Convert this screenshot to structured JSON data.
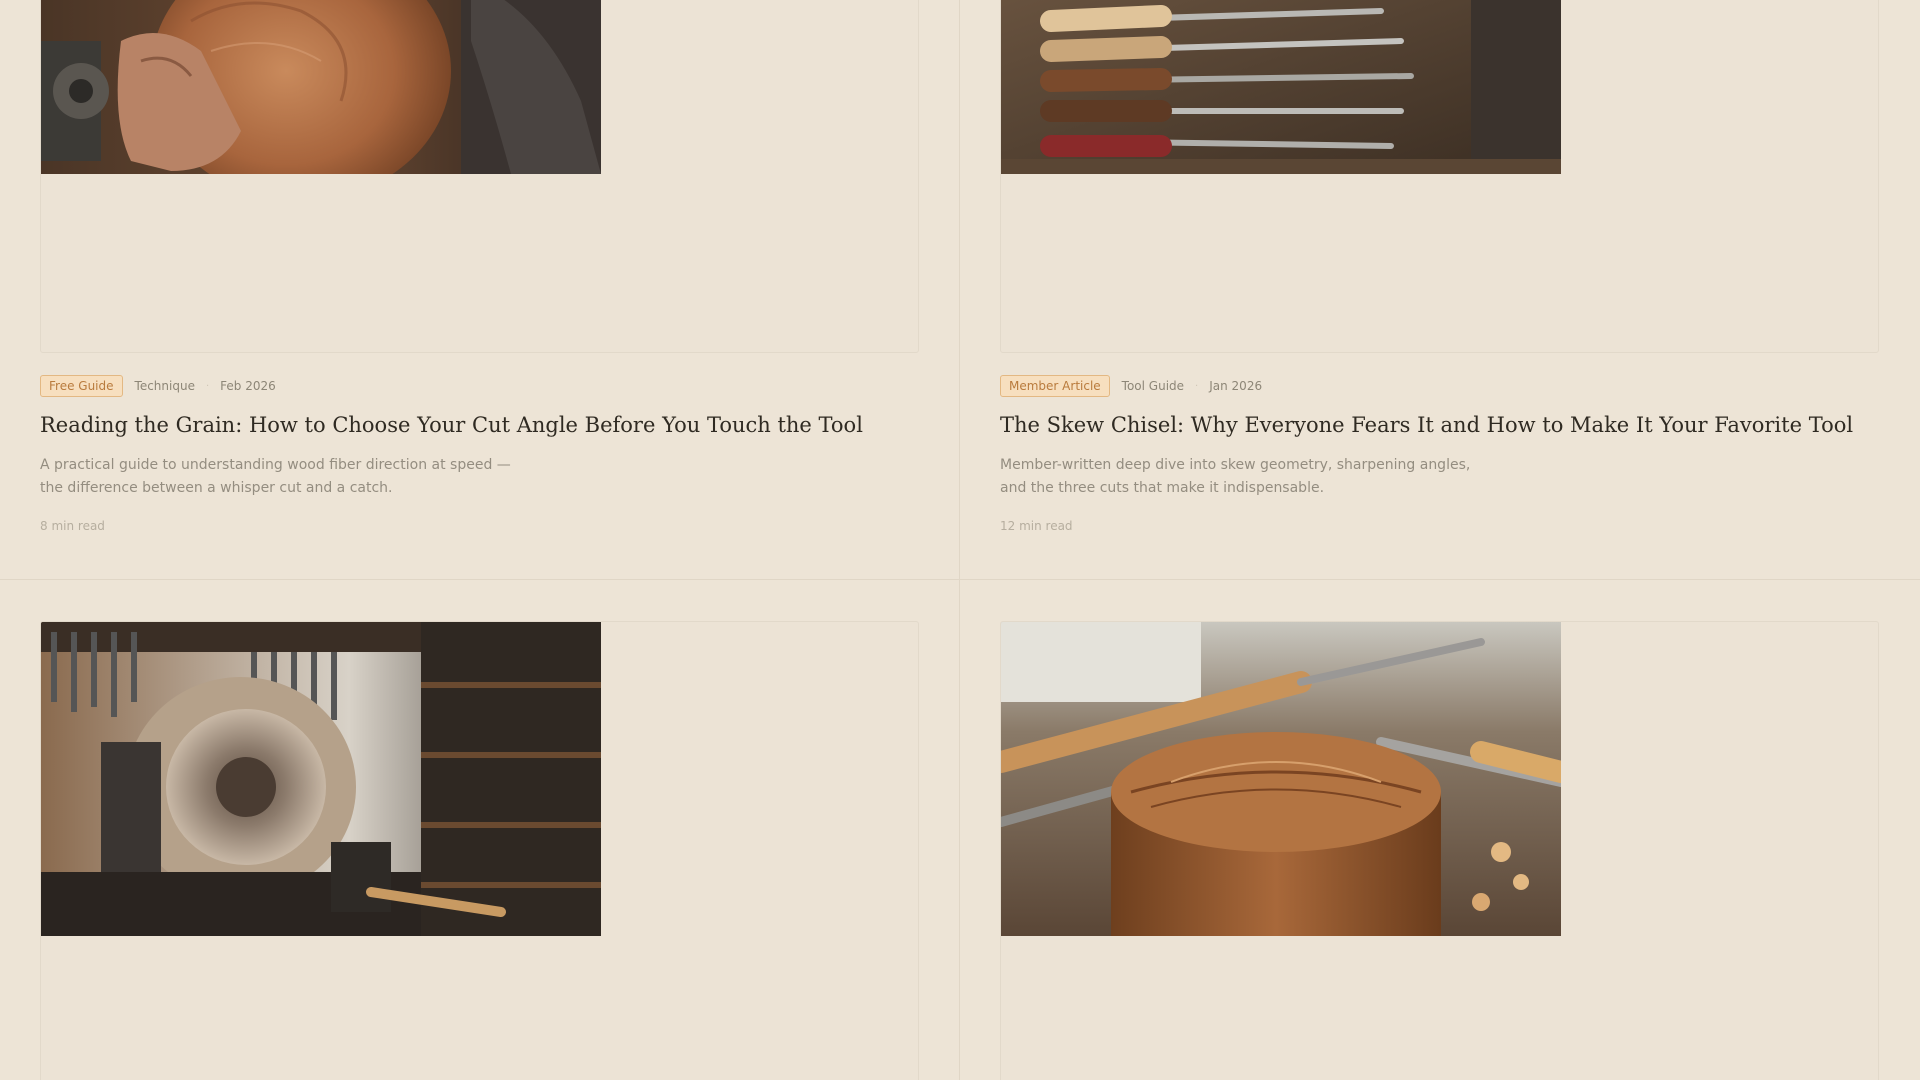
{
  "articles": [
    {
      "badge": "Free Guide",
      "category": "Technique",
      "date": "Feb 2026",
      "title": "Reading the Grain: How to Choose Your Cut Angle Before You Touch the Tool",
      "excerpt": "A practical guide to understanding wood fiber direction at speed — the difference between a whisper cut and a catch.",
      "read_time": "8 min read",
      "image": "hands-turning-bowl-photo"
    },
    {
      "badge": "Member Article",
      "category": "Tool Guide",
      "date": "Jan 2026",
      "title": "The Skew Chisel: Why Everyone Fears It and How to Make It Your Favorite Tool",
      "excerpt": "Member-written deep dive into skew geometry, sharpening angles, and the three cuts that make it indispensable.",
      "read_time": "12 min read",
      "image": "chisel-set-photo"
    },
    {
      "image": "lathe-bowl-workshop-photo"
    },
    {
      "image": "wooden-box-photo"
    }
  ],
  "colors": {
    "page_bg": "#ede4d6",
    "badge_bg": "#f7dfbf",
    "badge_text": "#b97b3d",
    "title_text": "#2f2a22"
  }
}
